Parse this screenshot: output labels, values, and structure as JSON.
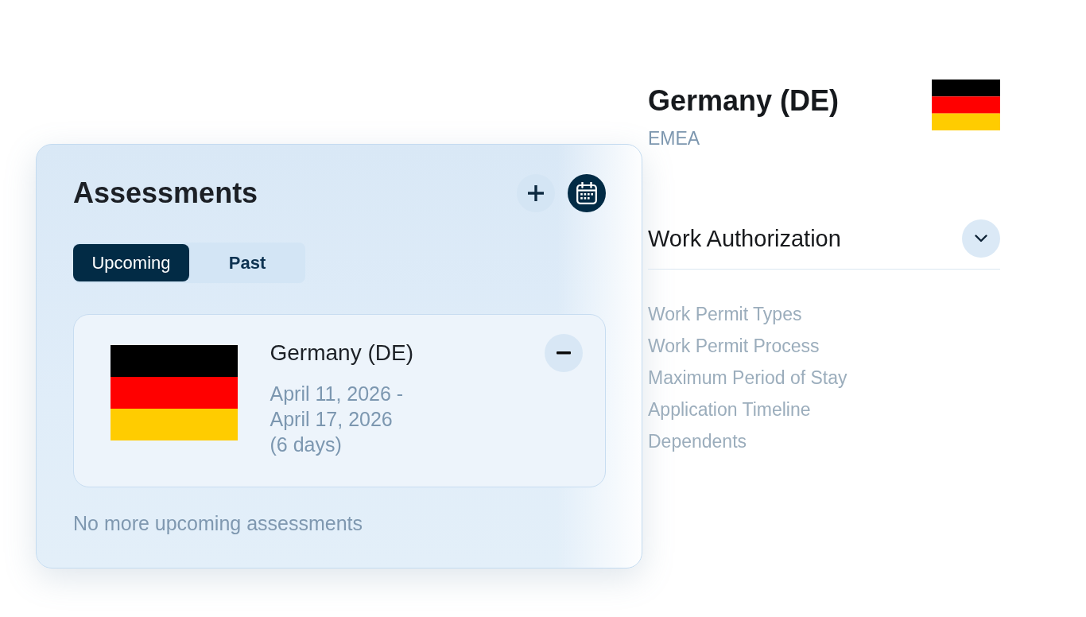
{
  "assessments": {
    "title": "Assessments",
    "tabs": [
      {
        "label": "Upcoming",
        "selected": true
      },
      {
        "label": "Past",
        "selected": false
      }
    ],
    "items": [
      {
        "country": "Germany (DE)",
        "dates": "April 11, 2026 - April 17, 2026 (6 days)"
      }
    ],
    "empty_note": "No more upcoming assessments"
  },
  "country": {
    "name": "Germany (DE)",
    "region": "EMEA",
    "section": {
      "title": "Work Authorization",
      "links": [
        "Work Permit Types",
        "Work Permit Process",
        "Maximum Period of Stay",
        "Application Timeline",
        "Dependents"
      ]
    }
  }
}
